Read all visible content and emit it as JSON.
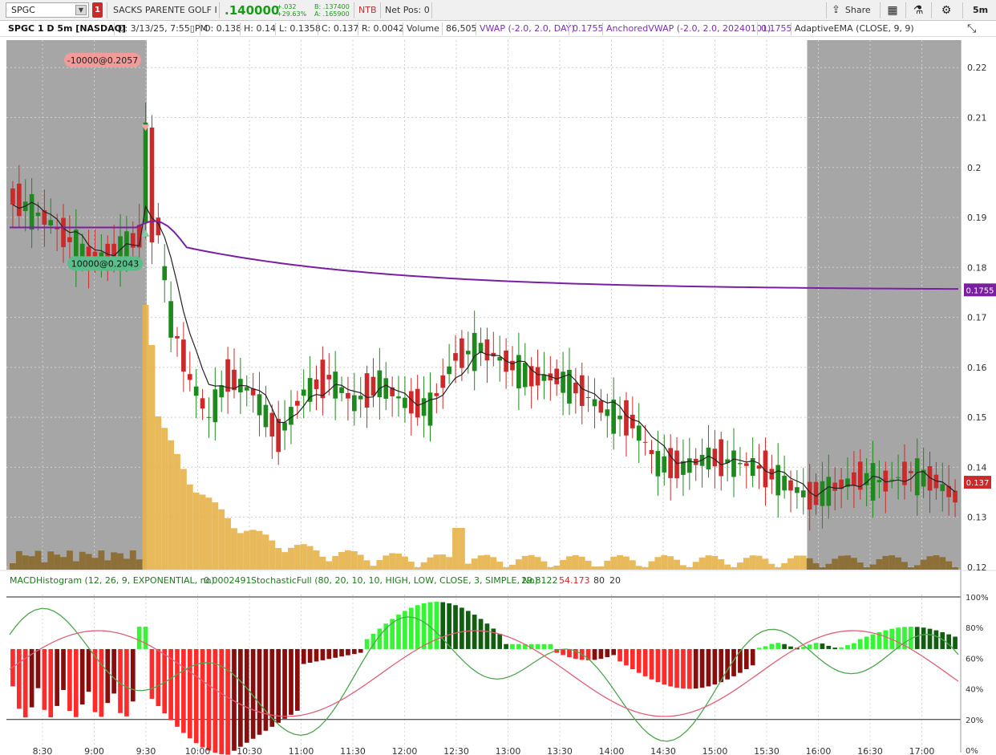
{
  "toolbar": {
    "symbol": "SPGC",
    "link_badge": "1",
    "company": "SACKS PARENTE GOLF I",
    "last_price": ".140000",
    "change_abs": "+.032",
    "change_pct": "+29.63%",
    "bid": "B: .137400",
    "ask": "A: .165900",
    "ntb": "NTB",
    "net_pos": "Net Pos: 0",
    "share_label": "Share",
    "timeframe": "5m",
    "colors": {
      "up": "#199a19",
      "down": "#cc2a2a"
    }
  },
  "header": {
    "title": "SPGC 1 D 5m [NASDAQ]",
    "date": "D: 3/13/25, 7:55▯PM",
    "open": "O: 0.138",
    "high": "H: 0.14",
    "low": "L: 0.1358",
    "close": "C: 0.137",
    "range": "R: 0.0042",
    "volume_label": "Volume",
    "volume_value": "86,505",
    "vwap_label": "VWAP (-2.0, 2.0, DAY)",
    "vwap_value": "0.1755",
    "avwap_label": "AnchoredVWAP (-2.0, 2.0, 20240101)",
    "avwap_value": "0.1755",
    "ema_label": "AdaptiveEMA (CLOSE, 9, 9)"
  },
  "lower_header": {
    "macd_label": "MACDHistogram (12, 26, 9, EXPONENTIAL, no)",
    "macd_value": "0.0002491",
    "stoch_label": "StochasticFull (80, 20, 10, 10, HIGH, LOW, CLOSE, 3, SIMPLE, No)",
    "stoch_k": "29.8122",
    "stoch_d": "54.173",
    "ob": "80",
    "os": "20"
  },
  "chart_data": {
    "type": "candlestick",
    "timeframe": "5m",
    "premarket_end": "09:30",
    "afterhours_start": "16:00",
    "y_ticks": [
      "0.22",
      "0.21",
      "0.2",
      "0.19",
      "0.18",
      "0.17",
      "0.16",
      "0.15",
      "0.14",
      "0.13",
      "0.12"
    ],
    "ylim": [
      0.1195,
      0.2255
    ],
    "x_ticks": [
      "8:30",
      "9:00",
      "9:30",
      "10:00",
      "10:30",
      "11:00",
      "11:30",
      "12:00",
      "12:30",
      "13:00",
      "13:30",
      "14:00",
      "14:30",
      "15:00",
      "15:30",
      "16:00",
      "16:30",
      "17:00"
    ],
    "vwap_value": 0.1755,
    "last_close": 0.137,
    "last_label": "0.137",
    "vwap_label": "0.1755",
    "trade_markers": [
      {
        "label": "-10000@0.2057",
        "side": "sell",
        "price": 0.2057
      },
      {
        "label": "10000@0.2043",
        "side": "buy",
        "price": 0.2043
      }
    ],
    "stoch_ticks": [
      "100%",
      "80%",
      "60%",
      "40%",
      "20%",
      "0%"
    ],
    "colors": {
      "up": "#1e8a1e",
      "down": "#cc2a2a",
      "vwap": "#7b1fa2",
      "ema": "#222222",
      "volume": "#e6b24a",
      "volume_ext": "#8a6a2c",
      "ext_bg": "#a6a6a6",
      "hist_up_strong": "#35f535",
      "hist_up_weak": "#0f5f0f",
      "hist_down_strong": "#ff2a2a",
      "hist_down_weak": "#8a0d0d",
      "stoch_k": "#4ea64e",
      "stoch_d": "#e0607a"
    }
  }
}
